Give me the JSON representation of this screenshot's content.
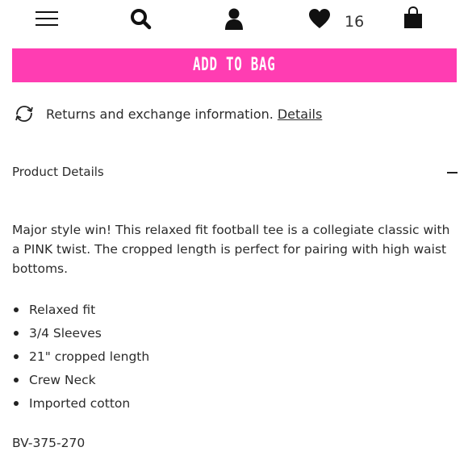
{
  "nav": {
    "menu_icon": "hamburger-menu-icon",
    "search_icon": "search-icon",
    "account_icon": "user-icon",
    "wishlist_icon": "heart-icon",
    "wishlist_count": "16",
    "bag_icon": "shopping-bag-icon"
  },
  "cta": {
    "add_to_bag_label": "ADD TO BAG",
    "color": "#ff3db2"
  },
  "returns": {
    "icon": "exchange-arrows-icon",
    "text": "Returns and exchange information.",
    "link_label": "Details"
  },
  "product_details": {
    "title": "Product Details",
    "toggle_icon": "minus-icon",
    "description": "Major style win! This relaxed fit football tee is a collegiate classic with a PINK twist. The cropped length is perfect for pairing with high waist bottoms.",
    "features": [
      "Relaxed fit",
      "3/4 Sleeves",
      "21\" cropped length",
      "Crew Neck",
      "Imported cotton"
    ],
    "sku": "BV-375-270"
  }
}
